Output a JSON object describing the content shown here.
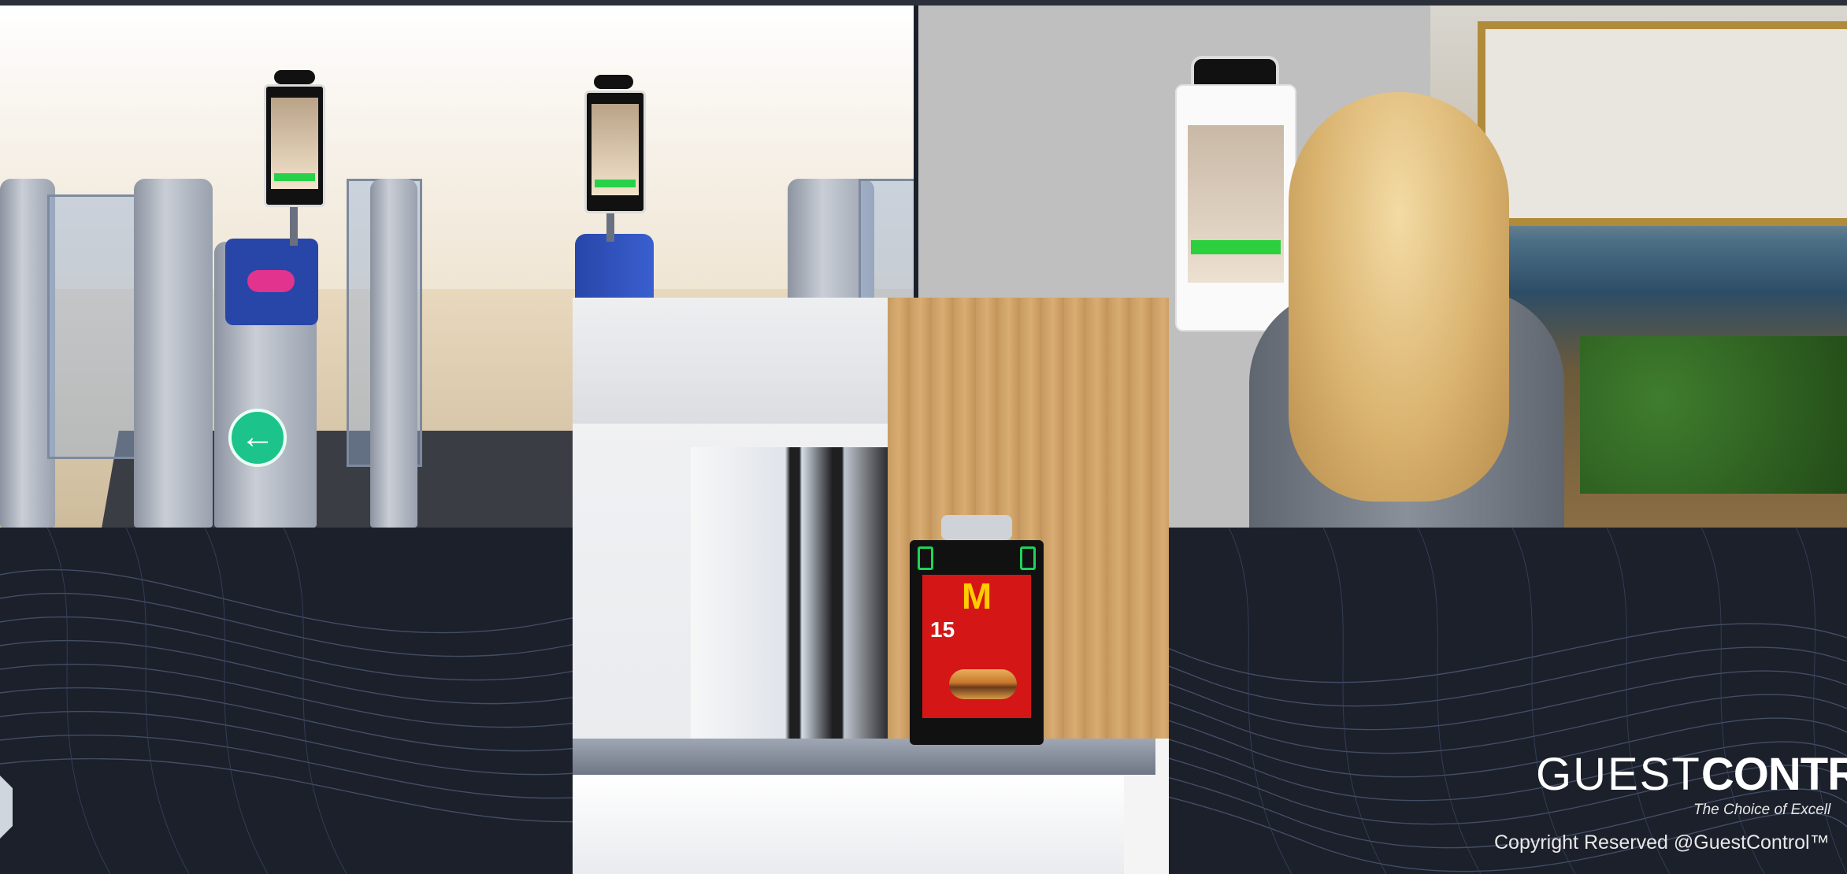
{
  "branding": {
    "logo_part1": "GUEST",
    "logo_part2": "CONTRO",
    "tagline": "The Choice of Excell",
    "copyright": "Copyright Reserved @GuestControl™"
  },
  "panels": [
    {
      "name": "turnstile-gates-photo",
      "content": ""
    },
    {
      "name": "woman-kiosk-photo",
      "content": ""
    },
    {
      "name": "restaurant-counter-kiosk-photo",
      "content": ""
    }
  ],
  "mcd_screen": {
    "logo": "M",
    "promo_number": "15"
  },
  "colors": {
    "background": "#1b202b",
    "accent_green": "#27d24a",
    "mcd_red": "#d51616",
    "mcd_yellow": "#ffcc00"
  }
}
